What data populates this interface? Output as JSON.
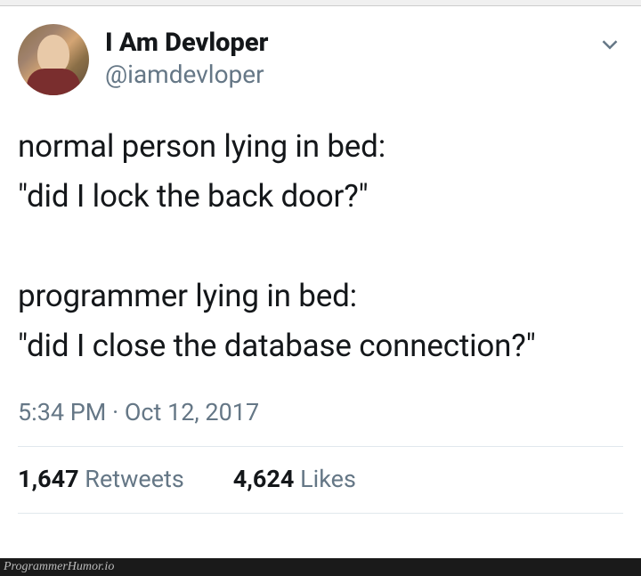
{
  "user": {
    "display_name": "I Am Devloper",
    "handle": "@iamdevloper"
  },
  "tweet": {
    "text": "normal person lying in bed:\n\"did I lock the back door?\"\n\nprogrammer lying in bed:\n\"did I close the database connection?\""
  },
  "meta": {
    "time": "5:34 PM",
    "separator": " · ",
    "date": "Oct 12, 2017"
  },
  "stats": {
    "retweet_count": "1,647",
    "retweet_label": " Retweets",
    "like_count": "4,624",
    "like_label": " Likes"
  },
  "watermark": "ProgrammerHumor.io"
}
